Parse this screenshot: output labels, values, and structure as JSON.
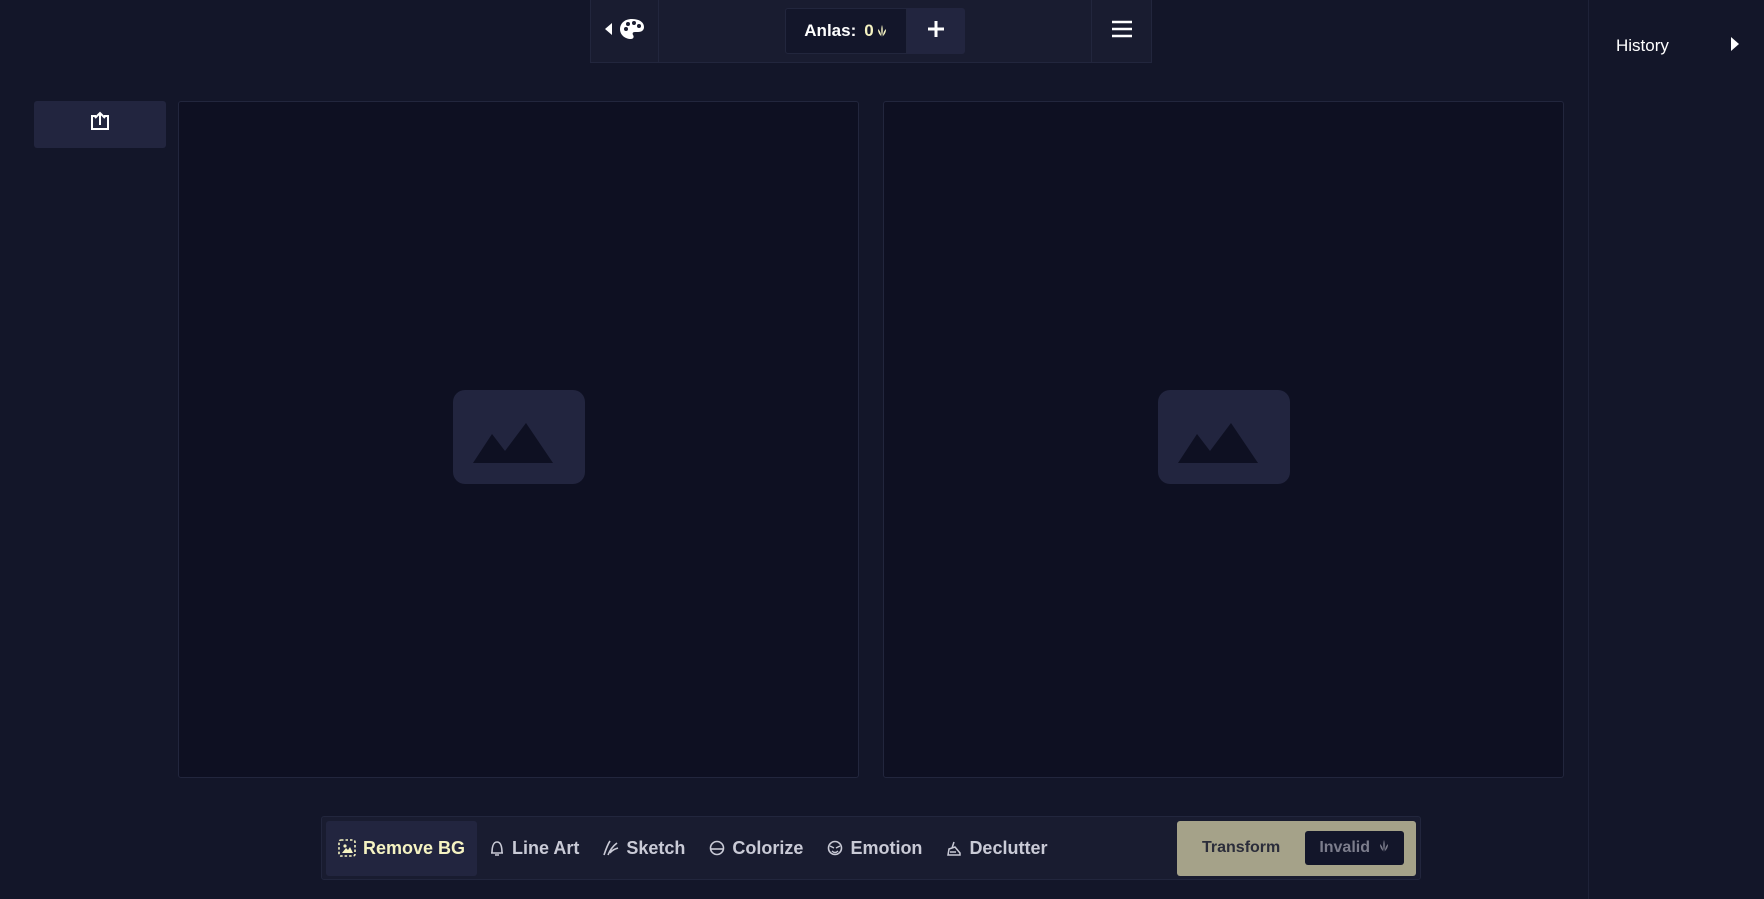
{
  "topbar": {
    "back_icon": "caret-left-icon",
    "palette_icon": "palette-icon",
    "anlas_label": "Anlas:",
    "anlas_value": "0",
    "anlas_icon": "anlas-seed-icon",
    "add_icon": "plus-icon",
    "menu_icon": "hamburger-menu-icon"
  },
  "upload": {
    "icon": "upload-icon"
  },
  "panels": [
    {
      "icon": "image-placeholder-icon"
    },
    {
      "icon": "image-placeholder-icon"
    }
  ],
  "history": {
    "title": "History",
    "toggle_icon": "caret-right-icon"
  },
  "tools": [
    {
      "label": "Remove BG",
      "icon": "remove-bg-icon",
      "active": true
    },
    {
      "label": "Line Art",
      "icon": "line-art-icon",
      "active": false
    },
    {
      "label": "Sketch",
      "icon": "sketch-icon",
      "active": false
    },
    {
      "label": "Colorize",
      "icon": "colorize-icon",
      "active": false
    },
    {
      "label": "Emotion",
      "icon": "emotion-icon",
      "active": false
    },
    {
      "label": "Declutter",
      "icon": "declutter-icon",
      "active": false
    }
  ],
  "transform": {
    "label": "Transform",
    "cost_label": "Invalid",
    "cost_icon": "anlas-seed-icon"
  },
  "colors": {
    "background": "#131629",
    "panel": "#0e1022",
    "accent_text": "#f5f3c2",
    "transform_button": "#a5a289"
  }
}
